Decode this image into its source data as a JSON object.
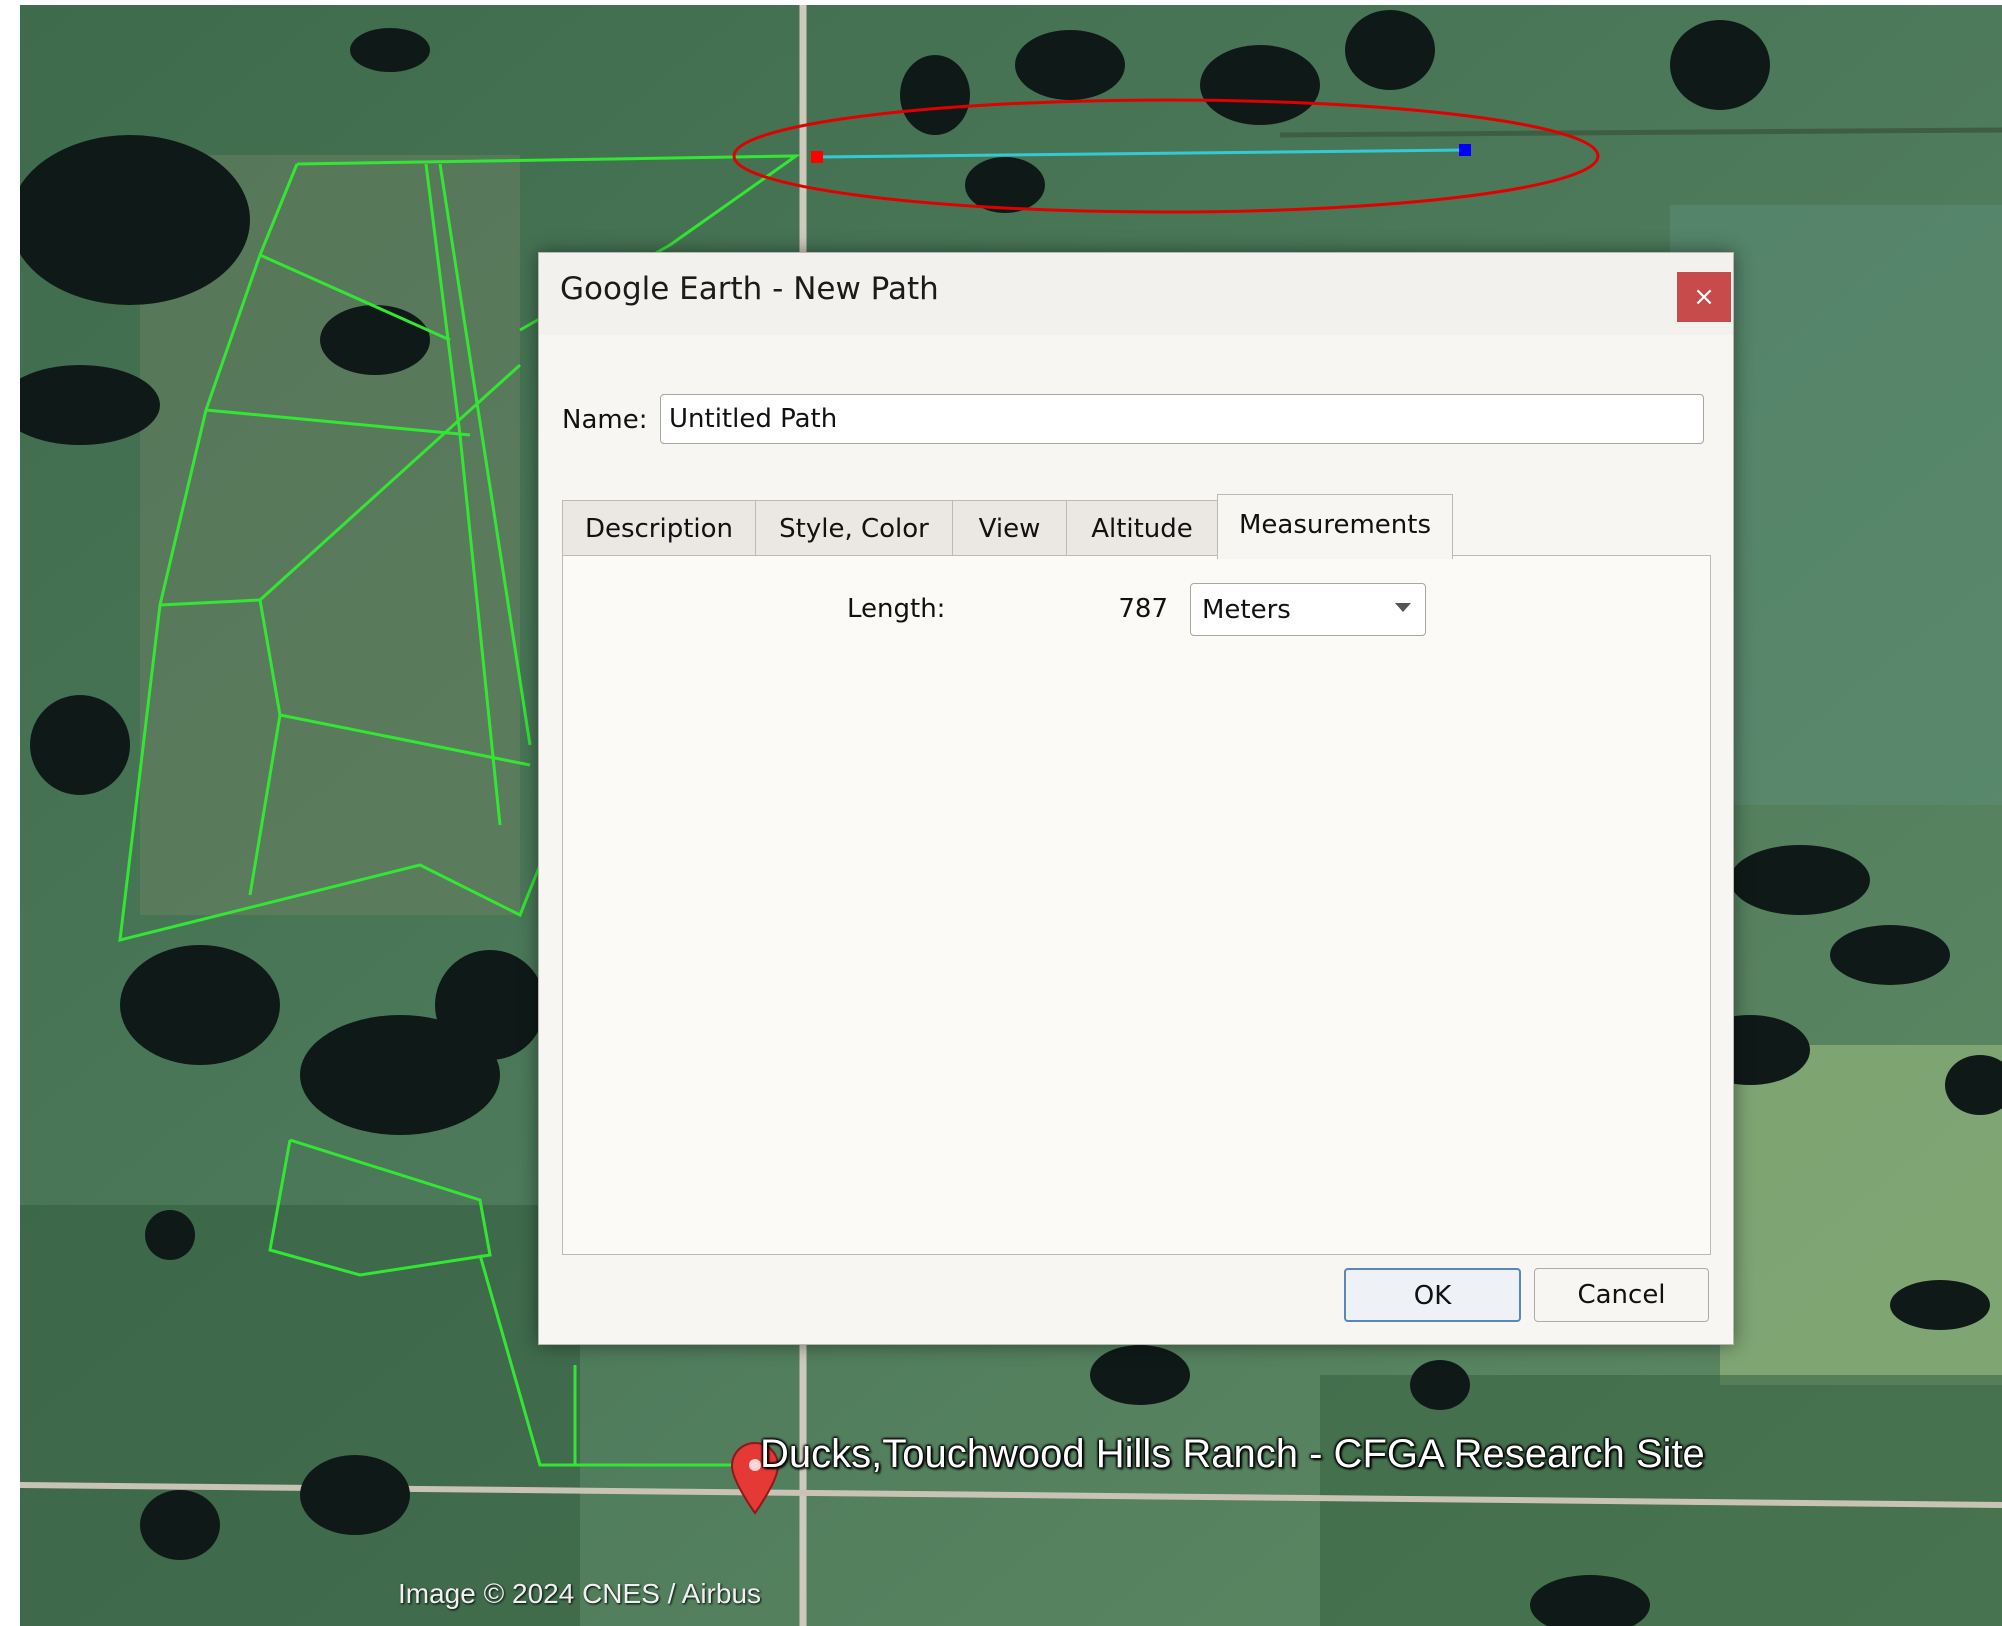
{
  "dialog": {
    "title": "Google Earth - New Path",
    "close_glyph": "×",
    "name_label": "Name:",
    "name_value": "Untitled Path",
    "tabs": [
      {
        "label": "Description",
        "active": false
      },
      {
        "label": "Style, Color",
        "active": false
      },
      {
        "label": "View",
        "active": false
      },
      {
        "label": "Altitude",
        "active": false
      },
      {
        "label": "Measurements",
        "active": true
      }
    ],
    "measurements": {
      "length_label": "Length:",
      "length_value": "787",
      "unit_selected": "Meters"
    },
    "buttons": {
      "ok": "OK",
      "cancel": "Cancel"
    }
  },
  "map": {
    "placemark_label": "Ducks,Touchwood Hills Ranch - CFGA Research Site",
    "attribution": "Image © 2024 CNES / Airbus",
    "path_start_color": "#ff0000",
    "path_end_color": "#0000ff",
    "path_line_color": "#35c9d6",
    "boundary_color": "#33e633",
    "highlight_color": "#e00000"
  },
  "icons": {
    "placemark": "placemark-pin-icon",
    "close": "close-icon",
    "dropdown": "chevron-down-icon"
  }
}
